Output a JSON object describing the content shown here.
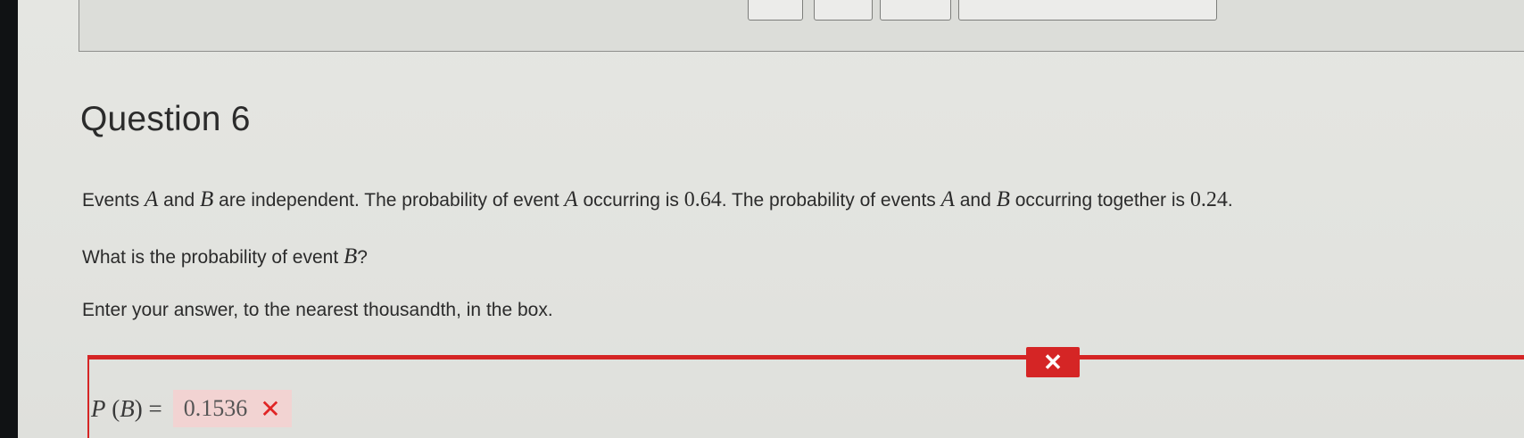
{
  "question": {
    "title": "Question 6",
    "stem": {
      "t1": "Events ",
      "varA": "A",
      "t2": " and ",
      "varB": "B",
      "t3": " are independent. The probability of event ",
      "varA2": "A",
      "t4": " occurring is ",
      "pA": "0.64",
      "t5": ". The probability of events ",
      "varA3": "A",
      "t6": " and ",
      "varB2": "B",
      "t7": " occurring together is ",
      "pAB": "0.24",
      "t8": "."
    },
    "prompt": {
      "t1": "What is the probability of event ",
      "varB": "B",
      "t2": "?"
    },
    "instruction": "Enter your answer, to the nearest thousandth, in the box."
  },
  "answer": {
    "label_p": "P",
    "label_open": " (",
    "label_b": "B",
    "label_close": ") = ",
    "value": "0.1536",
    "wrong_icon": "✕",
    "status_icon": "✕"
  },
  "colors": {
    "incorrect": "#d52525",
    "answer_bg": "#f2d3d2"
  },
  "icons": {
    "status": "close-icon",
    "wrong": "close-icon"
  }
}
